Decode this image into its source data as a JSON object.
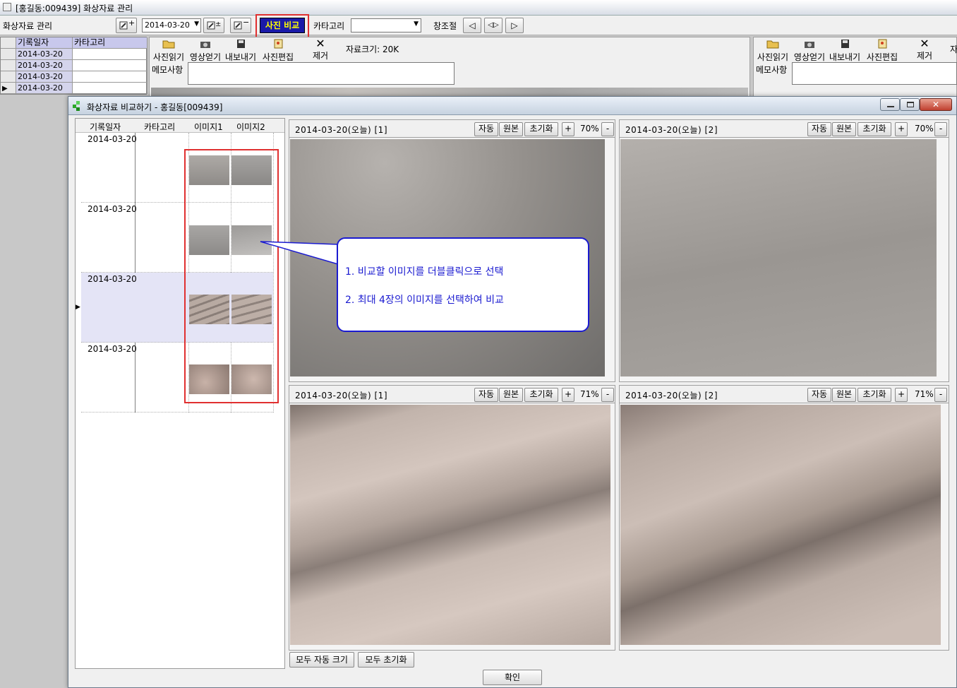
{
  "window": {
    "title": "[홍길동:009439] 화상자료 관리"
  },
  "toolbar": {
    "section_label": "화상자료 관리",
    "date_value": "2014-03-20",
    "compare_button": "사진 비교",
    "category_label": "카타고리",
    "category_value": "",
    "window_adjust_label": "창조절"
  },
  "record_list": {
    "headers": [
      "기록일자",
      "카타고리"
    ],
    "rows": [
      "2014-03-20",
      "2014-03-20",
      "2014-03-20",
      "2014-03-20"
    ]
  },
  "photo_panel_left": {
    "tools": [
      "사진읽기",
      "영상얻기",
      "내보내기",
      "사진편집",
      "제거"
    ],
    "size_label": "자료크기: 20K",
    "memo_label": "메모사항"
  },
  "photo_panel_right": {
    "tools": [
      "사진읽기",
      "영상얻기",
      "내보내기",
      "사진편집",
      "제거"
    ],
    "size_label": "자",
    "memo_label": "메모사항"
  },
  "dialog": {
    "title": "화상자료 비교하기 - 홍길동[009439]",
    "list_headers": [
      "기록일자",
      "카타고리",
      "이미지1",
      "이미지2"
    ],
    "list_rows": [
      {
        "date": "2014-03-20"
      },
      {
        "date": "2014-03-20"
      },
      {
        "date": "2014-03-20"
      },
      {
        "date": "2014-03-20"
      }
    ],
    "callout": {
      "line1": "1. 비교할 이미지를 더블클릭으로 선택",
      "line2": "2. 최대 4장의 이미지를 선택하여 비교"
    },
    "panels": [
      {
        "title": "2014-03-20(오늘) [1]",
        "zoom": "70%",
        "auto": "자동",
        "original": "원본",
        "reset": "초기화",
        "plus": "+",
        "minus": "-"
      },
      {
        "title": "2014-03-20(오늘) [2]",
        "zoom": "70%",
        "auto": "자동",
        "original": "원본",
        "reset": "초기화",
        "plus": "+",
        "minus": "-"
      },
      {
        "title": "2014-03-20(오늘) [1]",
        "zoom": "71%",
        "auto": "자동",
        "original": "원본",
        "reset": "초기화",
        "plus": "+",
        "minus": "-"
      },
      {
        "title": "2014-03-20(오늘) [2]",
        "zoom": "71%",
        "auto": "자동",
        "original": "원본",
        "reset": "초기화",
        "plus": "+",
        "minus": "-"
      }
    ],
    "all_auto_button": "모두 자동 크기",
    "all_reset_button": "모두 초기화",
    "ok_button": "확인"
  },
  "colors": {
    "highlight_red": "#e03030",
    "compare_btn_bg": "#1a1aa8",
    "compare_btn_text": "#ffff00",
    "callout_border": "#1a1ad0",
    "callout_text": "#1a1ad0",
    "selected_row": "#e4e4f6"
  }
}
